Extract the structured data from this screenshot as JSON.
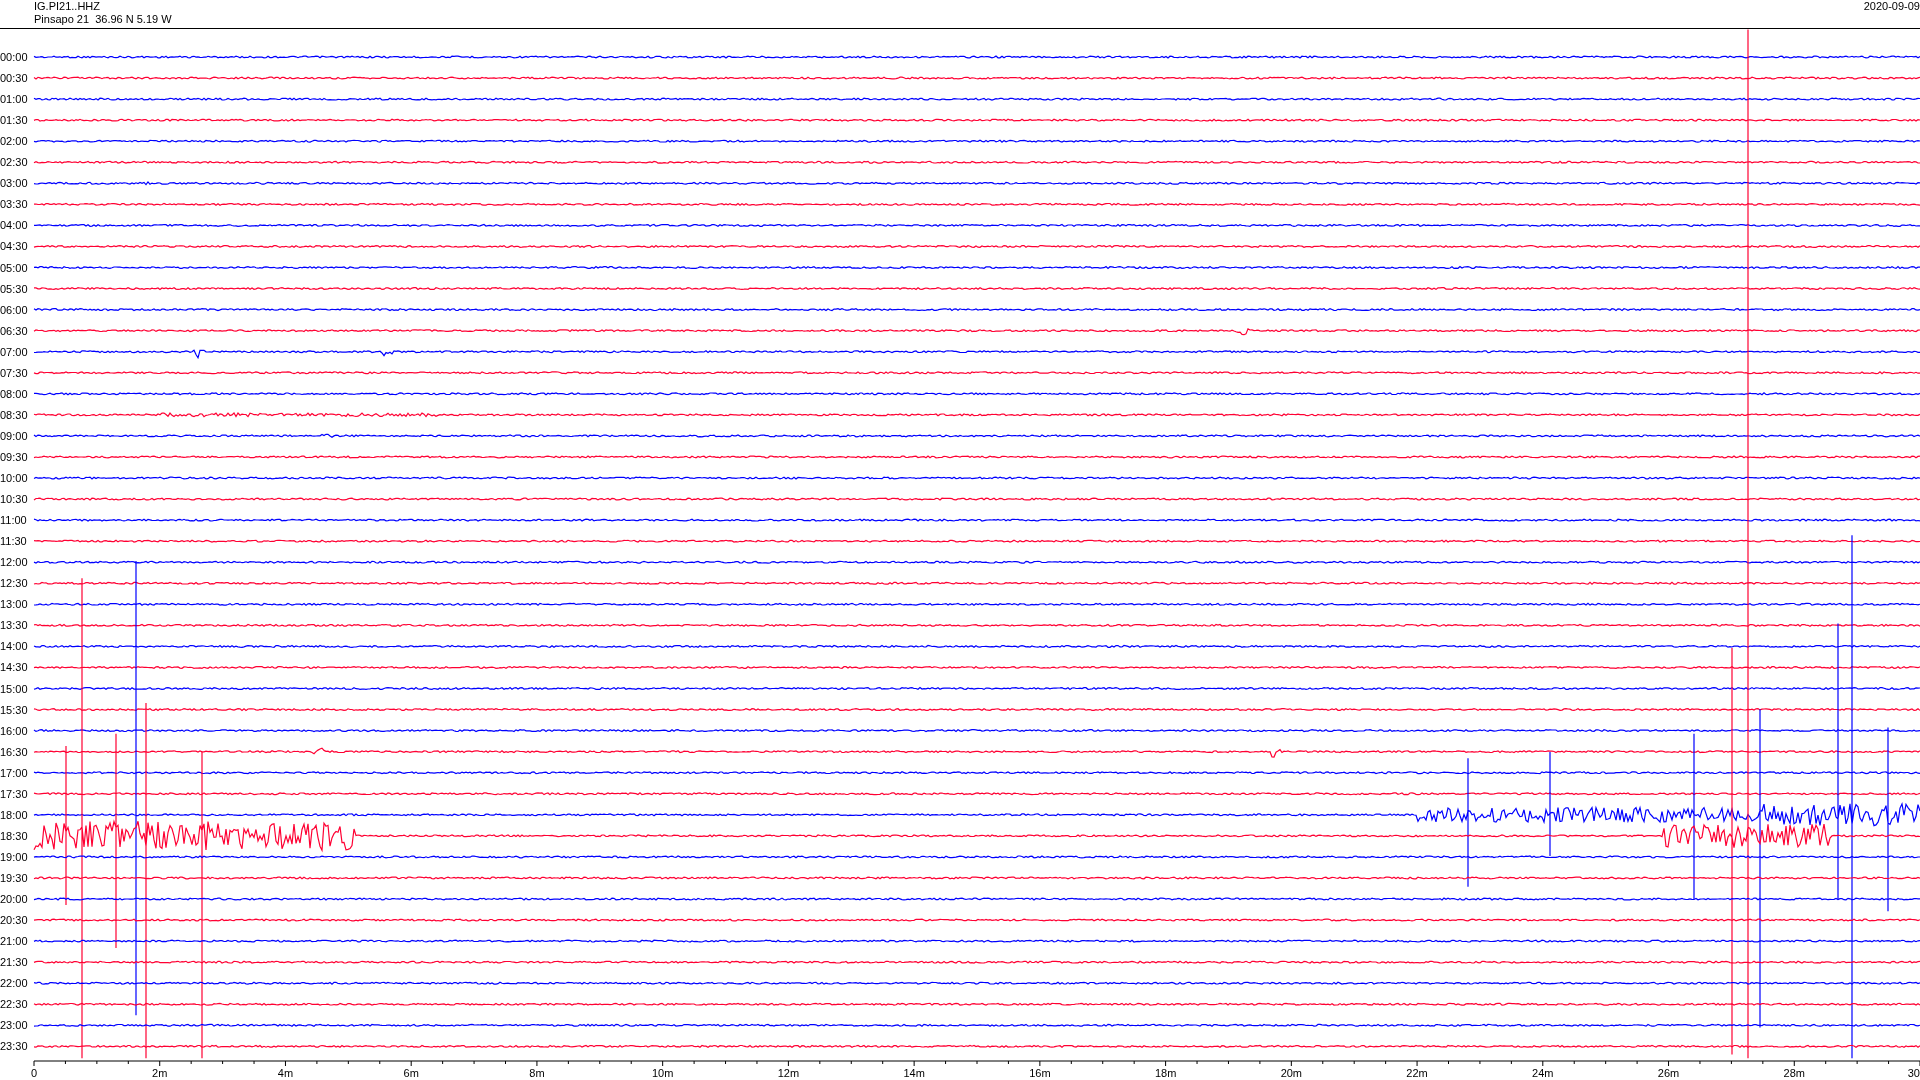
{
  "header": {
    "station": "IG.PI21..HHZ",
    "location": "Pinsapo 21  36.96 N 5.19 W",
    "date": "2020-09-09"
  },
  "rows": [
    {
      "label": "00:00",
      "color": "#0000ff"
    },
    {
      "label": "00:30",
      "color": "#ff0033"
    },
    {
      "label": "01:00",
      "color": "#0000ff"
    },
    {
      "label": "01:30",
      "color": "#ff0033"
    },
    {
      "label": "02:00",
      "color": "#0000ff"
    },
    {
      "label": "02:30",
      "color": "#ff0033"
    },
    {
      "label": "03:00",
      "color": "#0000ff"
    },
    {
      "label": "03:30",
      "color": "#ff0033"
    },
    {
      "label": "04:00",
      "color": "#0000ff"
    },
    {
      "label": "04:30",
      "color": "#ff0033"
    },
    {
      "label": "05:00",
      "color": "#0000ff"
    },
    {
      "label": "05:30",
      "color": "#ff0033"
    },
    {
      "label": "06:00",
      "color": "#0000ff"
    },
    {
      "label": "06:30",
      "color": "#ff0033"
    },
    {
      "label": "07:00",
      "color": "#0000ff"
    },
    {
      "label": "07:30",
      "color": "#ff0033"
    },
    {
      "label": "08:00",
      "color": "#0000ff"
    },
    {
      "label": "08:30",
      "color": "#ff0033"
    },
    {
      "label": "09:00",
      "color": "#0000ff"
    },
    {
      "label": "09:30",
      "color": "#ff0033"
    },
    {
      "label": "10:00",
      "color": "#0000ff"
    },
    {
      "label": "10:30",
      "color": "#ff0033"
    },
    {
      "label": "11:00",
      "color": "#0000ff"
    },
    {
      "label": "11:30",
      "color": "#ff0033"
    },
    {
      "label": "12:00",
      "color": "#0000ff"
    },
    {
      "label": "12:30",
      "color": "#ff0033"
    },
    {
      "label": "13:00",
      "color": "#0000ff"
    },
    {
      "label": "13:30",
      "color": "#ff0033"
    },
    {
      "label": "14:00",
      "color": "#0000ff"
    },
    {
      "label": "14:30",
      "color": "#ff0033"
    },
    {
      "label": "15:00",
      "color": "#0000ff"
    },
    {
      "label": "15:30",
      "color": "#ff0033"
    },
    {
      "label": "16:00",
      "color": "#0000ff"
    },
    {
      "label": "16:30",
      "color": "#ff0033"
    },
    {
      "label": "17:00",
      "color": "#0000ff"
    },
    {
      "label": "17:30",
      "color": "#ff0033"
    },
    {
      "label": "18:00",
      "color": "#0000ff"
    },
    {
      "label": "18:30",
      "color": "#ff0033"
    },
    {
      "label": "19:00",
      "color": "#0000ff"
    },
    {
      "label": "19:30",
      "color": "#ff0033"
    },
    {
      "label": "20:00",
      "color": "#0000ff"
    },
    {
      "label": "20:30",
      "color": "#ff0033"
    },
    {
      "label": "21:00",
      "color": "#0000ff"
    },
    {
      "label": "21:30",
      "color": "#ff0033"
    },
    {
      "label": "22:00",
      "color": "#0000ff"
    },
    {
      "label": "22:30",
      "color": "#ff0033"
    },
    {
      "label": "23:00",
      "color": "#0000ff"
    },
    {
      "label": "23:30",
      "color": "#ff0033"
    }
  ],
  "x_axis": {
    "ticks": [
      "0",
      "2m",
      "4m",
      "6m",
      "8m",
      "10m",
      "12m",
      "14m",
      "16m",
      "18m",
      "20m",
      "22m",
      "24m",
      "26m",
      "28m",
      "30"
    ]
  }
}
